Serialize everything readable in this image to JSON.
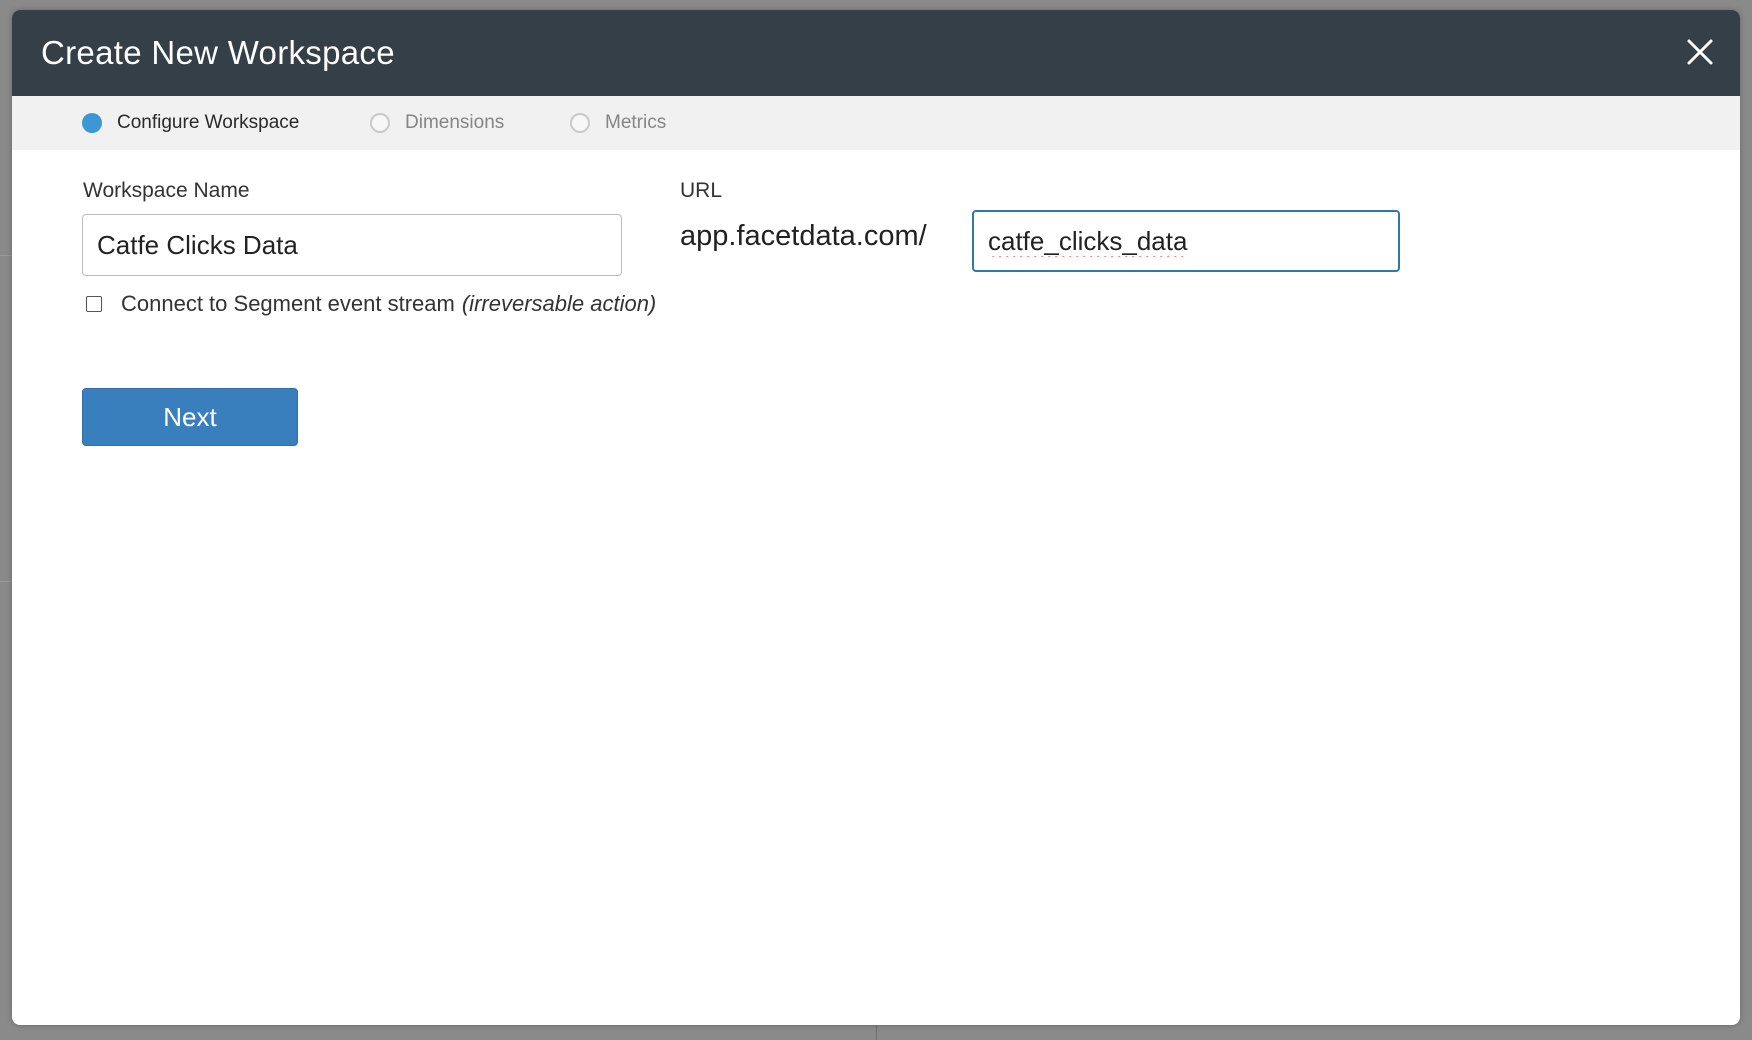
{
  "modal": {
    "title": "Create New Workspace"
  },
  "steps": [
    {
      "label": "Configure Workspace",
      "active": true
    },
    {
      "label": "Dimensions",
      "active": false
    },
    {
      "label": "Metrics",
      "active": false
    }
  ],
  "form": {
    "workspace_name_label": "Workspace Name",
    "workspace_name_value": "Catfe Clicks Data",
    "url_label": "URL",
    "url_prefix": "app.facetdata.com/",
    "url_value": "catfe_clicks_data",
    "segment_label": "Connect to Segment event stream",
    "segment_note": "(irreversable action)",
    "segment_checked": false,
    "next_label": "Next"
  },
  "colors": {
    "header_bg": "#353f48",
    "active_step": "#3b97d6",
    "primary_button": "#3a7fbd",
    "focused_input_border": "#2f78ad"
  },
  "icons": {
    "close": "close-icon",
    "step_active": "radio-filled-icon",
    "step_inactive": "radio-empty-icon"
  }
}
